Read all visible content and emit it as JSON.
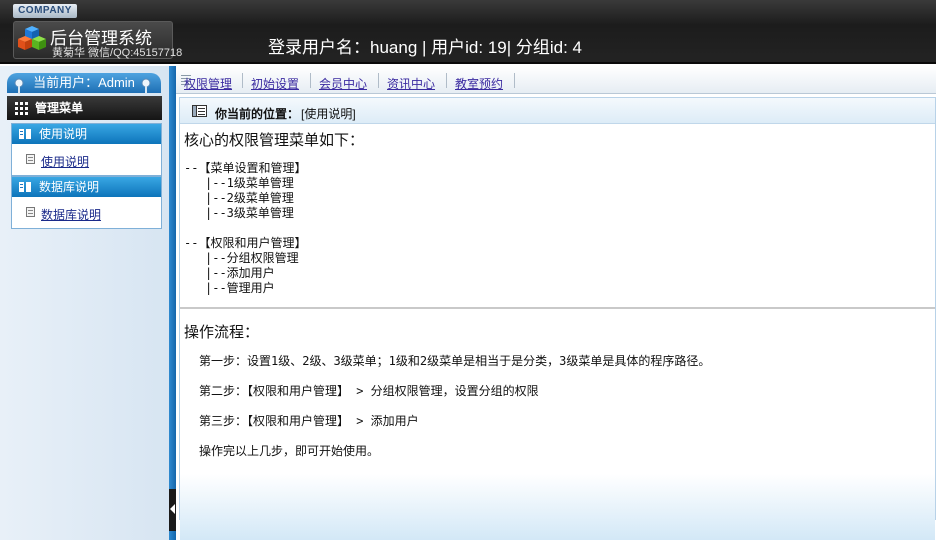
{
  "header": {
    "company": "COMPANY",
    "title": "后台管理系统",
    "author": "黄菊华 微信/QQ:45157718",
    "login_info": "登录用户名：huang | 用户id: 19| 分组id: 4"
  },
  "sidebar": {
    "current_user": "当前用户：Admin",
    "menu_title": "管理菜单",
    "sections": [
      {
        "title": "使用说明",
        "link": "使用说明"
      },
      {
        "title": "数据库说明",
        "link": "数据库说明"
      }
    ]
  },
  "top_nav": {
    "items": [
      "权限管理",
      "初始设置",
      "会员中心",
      "资讯中心",
      "教室预约"
    ]
  },
  "breadcrumb": {
    "label": "你当前的位置：",
    "value": "[使用说明]"
  },
  "article": {
    "heading1": "核心的权限管理菜单如下：",
    "tree1_root": "--【菜单设置和管理】",
    "tree1_items": [
      "|--1级菜单管理",
      "|--2级菜单管理",
      "|--3级菜单管理"
    ],
    "tree2_root": "--【权限和用户管理】",
    "tree2_items": [
      "|--分组权限管理",
      "|--添加用户",
      "|--管理用户"
    ],
    "heading2": "操作流程：",
    "steps": [
      "第一步：设置1级、2级、3级菜单；1级和2级菜单是相当于是分类，3级菜单是具体的程序路径。",
      "第二步：【权限和用户管理】 > 分组权限管理，设置分组的权限",
      "第三步：【权限和用户管理】 > 添加用户",
      "操作完以上几步，即可开始使用。"
    ]
  },
  "colors": {
    "header_bg": "#232323",
    "sidebar_blue": "#1e6fb4",
    "link": "#3a2aa0"
  }
}
